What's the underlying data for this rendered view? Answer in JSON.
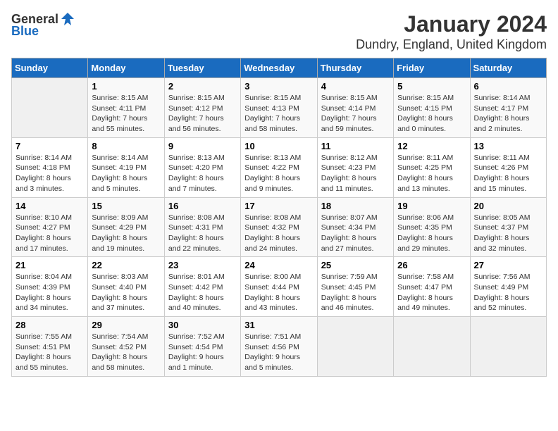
{
  "logo": {
    "general": "General",
    "blue": "Blue"
  },
  "title": "January 2024",
  "subtitle": "Dundry, England, United Kingdom",
  "colors": {
    "header_bg": "#1a6bbf",
    "header_text": "#ffffff"
  },
  "weekdays": [
    "Sunday",
    "Monday",
    "Tuesday",
    "Wednesday",
    "Thursday",
    "Friday",
    "Saturday"
  ],
  "weeks": [
    [
      {
        "day": "",
        "sunrise": "",
        "sunset": "",
        "daylight": ""
      },
      {
        "day": "1",
        "sunrise": "Sunrise: 8:15 AM",
        "sunset": "Sunset: 4:11 PM",
        "daylight": "Daylight: 7 hours and 55 minutes."
      },
      {
        "day": "2",
        "sunrise": "Sunrise: 8:15 AM",
        "sunset": "Sunset: 4:12 PM",
        "daylight": "Daylight: 7 hours and 56 minutes."
      },
      {
        "day": "3",
        "sunrise": "Sunrise: 8:15 AM",
        "sunset": "Sunset: 4:13 PM",
        "daylight": "Daylight: 7 hours and 58 minutes."
      },
      {
        "day": "4",
        "sunrise": "Sunrise: 8:15 AM",
        "sunset": "Sunset: 4:14 PM",
        "daylight": "Daylight: 7 hours and 59 minutes."
      },
      {
        "day": "5",
        "sunrise": "Sunrise: 8:15 AM",
        "sunset": "Sunset: 4:15 PM",
        "daylight": "Daylight: 8 hours and 0 minutes."
      },
      {
        "day": "6",
        "sunrise": "Sunrise: 8:14 AM",
        "sunset": "Sunset: 4:17 PM",
        "daylight": "Daylight: 8 hours and 2 minutes."
      }
    ],
    [
      {
        "day": "7",
        "sunrise": "Sunrise: 8:14 AM",
        "sunset": "Sunset: 4:18 PM",
        "daylight": "Daylight: 8 hours and 3 minutes."
      },
      {
        "day": "8",
        "sunrise": "Sunrise: 8:14 AM",
        "sunset": "Sunset: 4:19 PM",
        "daylight": "Daylight: 8 hours and 5 minutes."
      },
      {
        "day": "9",
        "sunrise": "Sunrise: 8:13 AM",
        "sunset": "Sunset: 4:20 PM",
        "daylight": "Daylight: 8 hours and 7 minutes."
      },
      {
        "day": "10",
        "sunrise": "Sunrise: 8:13 AM",
        "sunset": "Sunset: 4:22 PM",
        "daylight": "Daylight: 8 hours and 9 minutes."
      },
      {
        "day": "11",
        "sunrise": "Sunrise: 8:12 AM",
        "sunset": "Sunset: 4:23 PM",
        "daylight": "Daylight: 8 hours and 11 minutes."
      },
      {
        "day": "12",
        "sunrise": "Sunrise: 8:11 AM",
        "sunset": "Sunset: 4:25 PM",
        "daylight": "Daylight: 8 hours and 13 minutes."
      },
      {
        "day": "13",
        "sunrise": "Sunrise: 8:11 AM",
        "sunset": "Sunset: 4:26 PM",
        "daylight": "Daylight: 8 hours and 15 minutes."
      }
    ],
    [
      {
        "day": "14",
        "sunrise": "Sunrise: 8:10 AM",
        "sunset": "Sunset: 4:27 PM",
        "daylight": "Daylight: 8 hours and 17 minutes."
      },
      {
        "day": "15",
        "sunrise": "Sunrise: 8:09 AM",
        "sunset": "Sunset: 4:29 PM",
        "daylight": "Daylight: 8 hours and 19 minutes."
      },
      {
        "day": "16",
        "sunrise": "Sunrise: 8:08 AM",
        "sunset": "Sunset: 4:31 PM",
        "daylight": "Daylight: 8 hours and 22 minutes."
      },
      {
        "day": "17",
        "sunrise": "Sunrise: 8:08 AM",
        "sunset": "Sunset: 4:32 PM",
        "daylight": "Daylight: 8 hours and 24 minutes."
      },
      {
        "day": "18",
        "sunrise": "Sunrise: 8:07 AM",
        "sunset": "Sunset: 4:34 PM",
        "daylight": "Daylight: 8 hours and 27 minutes."
      },
      {
        "day": "19",
        "sunrise": "Sunrise: 8:06 AM",
        "sunset": "Sunset: 4:35 PM",
        "daylight": "Daylight: 8 hours and 29 minutes."
      },
      {
        "day": "20",
        "sunrise": "Sunrise: 8:05 AM",
        "sunset": "Sunset: 4:37 PM",
        "daylight": "Daylight: 8 hours and 32 minutes."
      }
    ],
    [
      {
        "day": "21",
        "sunrise": "Sunrise: 8:04 AM",
        "sunset": "Sunset: 4:39 PM",
        "daylight": "Daylight: 8 hours and 34 minutes."
      },
      {
        "day": "22",
        "sunrise": "Sunrise: 8:03 AM",
        "sunset": "Sunset: 4:40 PM",
        "daylight": "Daylight: 8 hours and 37 minutes."
      },
      {
        "day": "23",
        "sunrise": "Sunrise: 8:01 AM",
        "sunset": "Sunset: 4:42 PM",
        "daylight": "Daylight: 8 hours and 40 minutes."
      },
      {
        "day": "24",
        "sunrise": "Sunrise: 8:00 AM",
        "sunset": "Sunset: 4:44 PM",
        "daylight": "Daylight: 8 hours and 43 minutes."
      },
      {
        "day": "25",
        "sunrise": "Sunrise: 7:59 AM",
        "sunset": "Sunset: 4:45 PM",
        "daylight": "Daylight: 8 hours and 46 minutes."
      },
      {
        "day": "26",
        "sunrise": "Sunrise: 7:58 AM",
        "sunset": "Sunset: 4:47 PM",
        "daylight": "Daylight: 8 hours and 49 minutes."
      },
      {
        "day": "27",
        "sunrise": "Sunrise: 7:56 AM",
        "sunset": "Sunset: 4:49 PM",
        "daylight": "Daylight: 8 hours and 52 minutes."
      }
    ],
    [
      {
        "day": "28",
        "sunrise": "Sunrise: 7:55 AM",
        "sunset": "Sunset: 4:51 PM",
        "daylight": "Daylight: 8 hours and 55 minutes."
      },
      {
        "day": "29",
        "sunrise": "Sunrise: 7:54 AM",
        "sunset": "Sunset: 4:52 PM",
        "daylight": "Daylight: 8 hours and 58 minutes."
      },
      {
        "day": "30",
        "sunrise": "Sunrise: 7:52 AM",
        "sunset": "Sunset: 4:54 PM",
        "daylight": "Daylight: 9 hours and 1 minute."
      },
      {
        "day": "31",
        "sunrise": "Sunrise: 7:51 AM",
        "sunset": "Sunset: 4:56 PM",
        "daylight": "Daylight: 9 hours and 5 minutes."
      },
      {
        "day": "",
        "sunrise": "",
        "sunset": "",
        "daylight": ""
      },
      {
        "day": "",
        "sunrise": "",
        "sunset": "",
        "daylight": ""
      },
      {
        "day": "",
        "sunrise": "",
        "sunset": "",
        "daylight": ""
      }
    ]
  ]
}
